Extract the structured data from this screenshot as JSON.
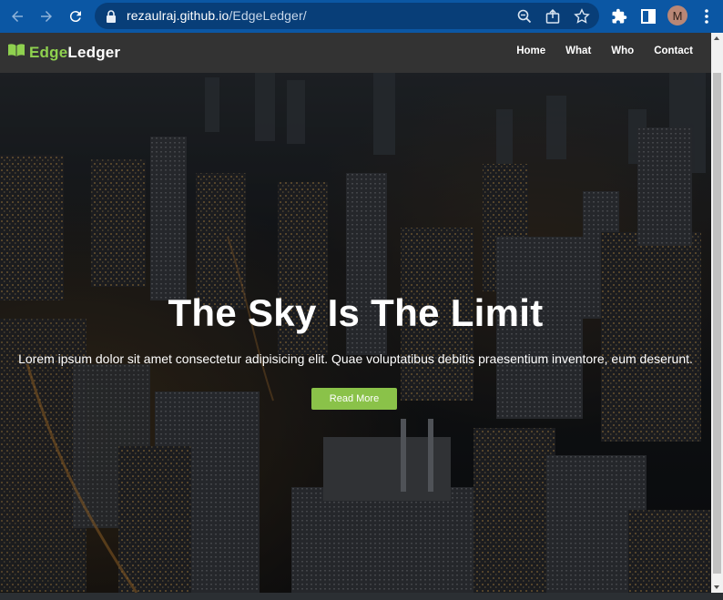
{
  "browser": {
    "url_host": "rezaulraj.github.io",
    "url_path": "/EdgeLedger/",
    "avatar_letter": "M",
    "icons": [
      "back-arrow-icon",
      "forward-arrow-icon",
      "reload-icon",
      "lock-icon",
      "zoom-icon",
      "share-icon",
      "bookmark-star-icon",
      "extensions-puzzle-icon",
      "side-panel-icon",
      "kebab-menu-icon"
    ]
  },
  "site": {
    "brand_part1": "Edge",
    "brand_part2": "Ledger",
    "brand_icon": "open-book-icon",
    "nav": [
      "Home",
      "What",
      "Who",
      "Contact"
    ]
  },
  "hero": {
    "title": "The Sky Is The Limit",
    "subtitle": "Lorem ipsum dolor sit amet consectetur adipisicing elit. Quae voluptatibus debitis praesentium inventore, eum deserunt.",
    "button": "Read More"
  },
  "colors": {
    "chrome_bar": "#0b57a4",
    "navbar": "#333333",
    "accent_green": "#8ac249"
  }
}
